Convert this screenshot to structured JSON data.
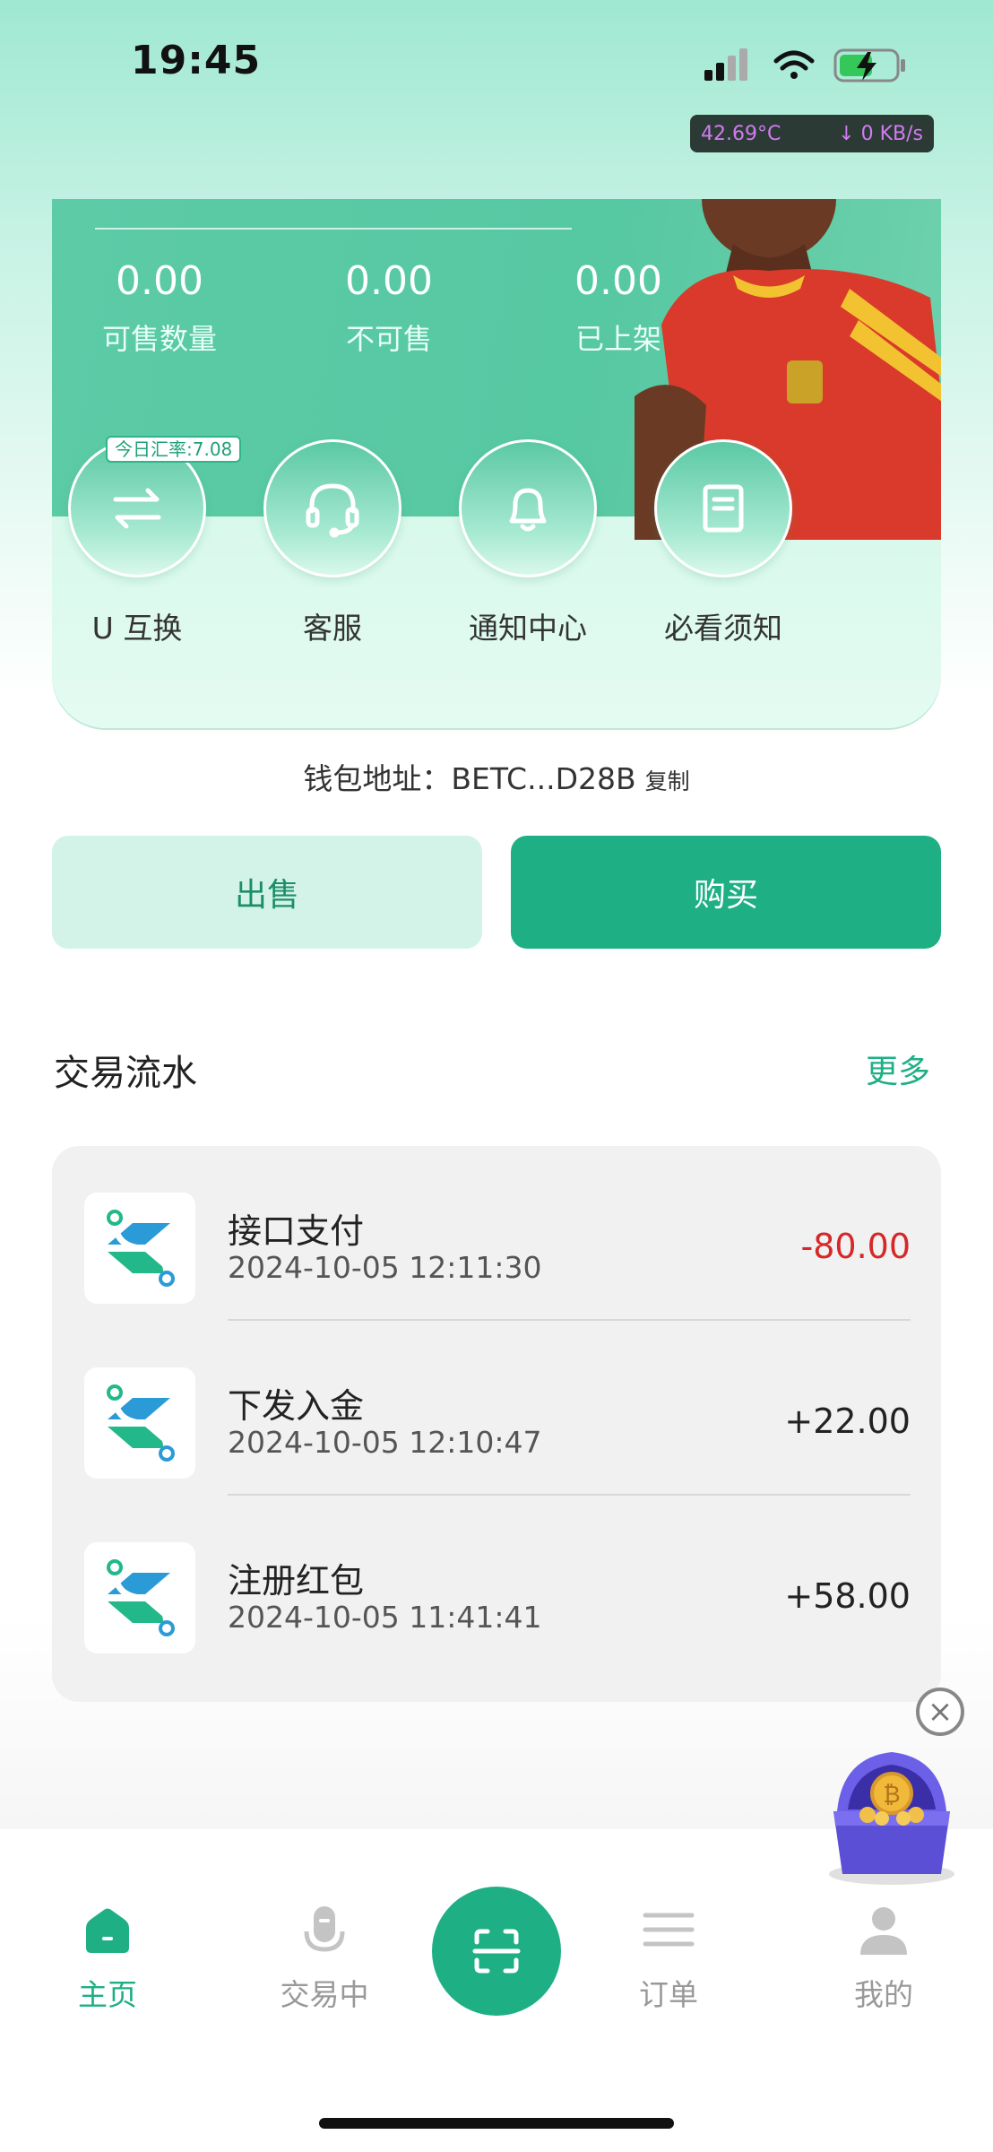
{
  "status_bar": {
    "time": "19:45",
    "temperature": "42.69°C",
    "net_speed": "↓ 0 KB/s"
  },
  "card": {
    "stats": [
      {
        "value": "0.00",
        "label": "可售数量"
      },
      {
        "value": "0.00",
        "label": "不可售"
      },
      {
        "value": "0.00",
        "label": "已上架"
      }
    ],
    "rate_tag": "今日汇率:7.08",
    "actions": [
      {
        "label": "U 互换",
        "icon": "swap-icon"
      },
      {
        "label": "客服",
        "icon": "headset-icon"
      },
      {
        "label": "通知中心",
        "icon": "bell-icon"
      },
      {
        "label": "必看须知",
        "icon": "document-icon"
      }
    ]
  },
  "wallet": {
    "label": "钱包地址：BETC...D28B",
    "copy": "复制"
  },
  "buttons": {
    "sell": "出售",
    "buy": "购买"
  },
  "transactions": {
    "title": "交易流水",
    "more": "更多",
    "items": [
      {
        "name": "接口支付",
        "date": "2024-10-05 12:11:30",
        "amount": "-80.00",
        "type": "negative"
      },
      {
        "name": "下发入金",
        "date": "2024-10-05 12:10:47",
        "amount": "+22.00",
        "type": "positive"
      },
      {
        "name": "注册红包",
        "date": "2024-10-05 11:41:41",
        "amount": "+58.00",
        "type": "positive"
      }
    ]
  },
  "tabbar": {
    "items": [
      {
        "label": "主页",
        "icon": "home-icon",
        "active": true
      },
      {
        "label": "交易中",
        "icon": "microphone-icon",
        "active": false
      },
      {
        "label": "订单",
        "icon": "list-icon",
        "active": false
      },
      {
        "label": "我的",
        "icon": "user-icon",
        "active": false
      }
    ]
  },
  "colors": {
    "brand": "#1eb084",
    "negative": "#d62828"
  }
}
